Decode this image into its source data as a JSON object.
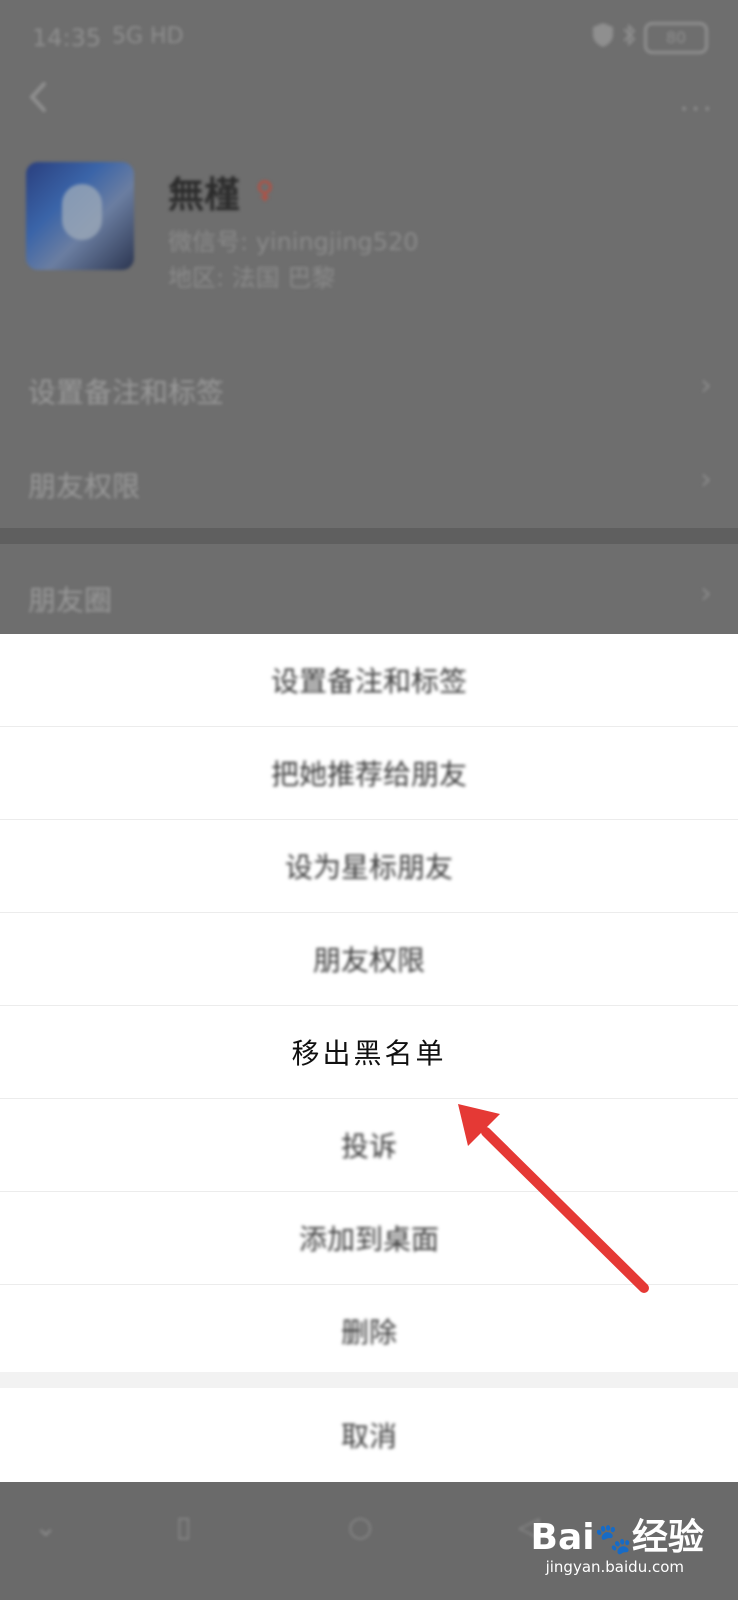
{
  "status_bar": {
    "time": "14:35",
    "network": "5G HD",
    "battery": "80"
  },
  "header": {
    "more_icon": "more-icon"
  },
  "profile": {
    "name": "無槿",
    "wechat_id": "微信号: yiningjing520",
    "region": "地区: 法国 巴黎"
  },
  "background_menu": [
    {
      "label": "设置备注和标签"
    },
    {
      "label": "朋友权限"
    },
    {
      "label": "朋友圈"
    }
  ],
  "action_sheet": {
    "items": [
      {
        "label": "设置备注和标签"
      },
      {
        "label": "把她推荐给朋友"
      },
      {
        "label": "设为星标朋友"
      },
      {
        "label": "朋友权限"
      },
      {
        "label": "移出黑名单"
      },
      {
        "label": "投诉"
      },
      {
        "label": "添加到桌面"
      },
      {
        "label": "删除"
      }
    ],
    "cancel": "取消"
  },
  "watermark": {
    "logo_text": "Bai",
    "logo_suffix": "经验",
    "url": "jingyan.baidu.com"
  },
  "annotation": {
    "arrow_color": "#e53935"
  }
}
